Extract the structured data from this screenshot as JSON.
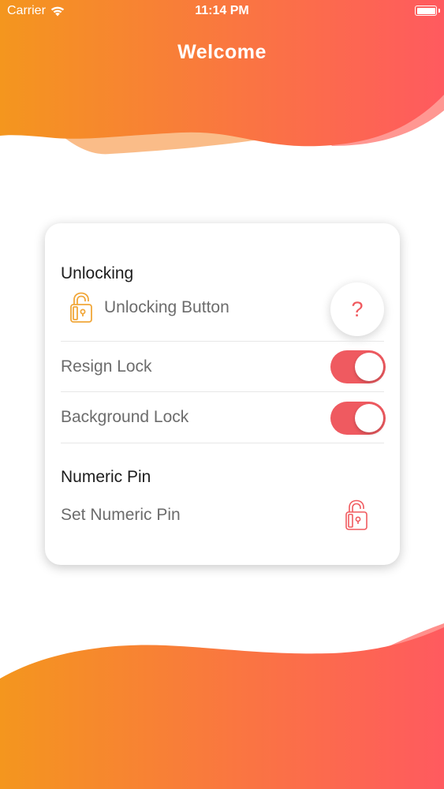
{
  "status_bar": {
    "carrier": "Carrier",
    "time": "11:14 PM"
  },
  "header": {
    "title": "Welcome"
  },
  "settings": {
    "unlocking": {
      "title": "Unlocking",
      "button_label": "Unlocking Button",
      "help_label": "?"
    },
    "resign_lock": {
      "label": "Resign Lock",
      "enabled": true
    },
    "background_lock": {
      "label": "Background Lock",
      "enabled": true
    },
    "numeric_pin": {
      "title": "Numeric Pin",
      "set_label": "Set Numeric Pin"
    }
  },
  "colors": {
    "gradient_start": "#F4961E",
    "gradient_end": "#FF5A5F",
    "accent": "#EF5A60",
    "lock_icon_gold": "#F1A73A",
    "lock_icon_red": "#F05A5F"
  },
  "icons": [
    "wifi-icon",
    "battery-icon",
    "padlock-icon",
    "question-icon"
  ]
}
